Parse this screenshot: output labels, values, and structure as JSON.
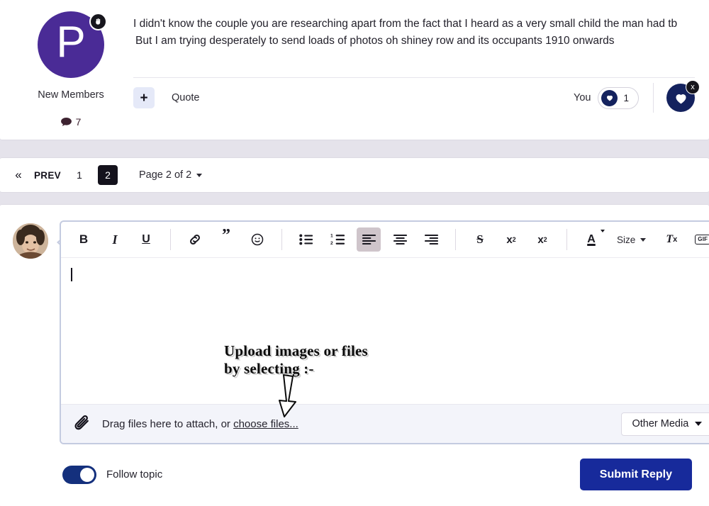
{
  "post": {
    "avatar_initial": "P",
    "rank_badge_icon": "hand-badge-icon",
    "member_group": "New Members",
    "post_count": "7",
    "body_lines": [
      "I didn't know the couple you are researching apart from the fact that I heard as a very small child the man had tb",
      "But I am trying desperately to send loads of photos oh shiney row and its occupants 1910 onwards"
    ],
    "plus_label": "+",
    "quote_label": "Quote",
    "reaction": {
      "you_label": "You",
      "count": "1",
      "heart_icon": "heart-icon",
      "remove_icon": "x"
    }
  },
  "pagination": {
    "first_icon": "«",
    "prev_label": "PREV",
    "pages": [
      {
        "label": "1",
        "active": false
      },
      {
        "label": "2",
        "active": true
      }
    ],
    "jump_label": "Page 2 of 2"
  },
  "editor": {
    "toolbar": [
      {
        "name": "bold-button",
        "label": "B"
      },
      {
        "name": "italic-button",
        "label": "I"
      },
      {
        "name": "underline-button",
        "label": "U"
      },
      {
        "name": "link-button",
        "label": "link-icon"
      },
      {
        "name": "quote-button",
        "label": "”"
      },
      {
        "name": "emoji-button",
        "label": "smiley-icon"
      },
      {
        "name": "bullet-list-button",
        "label": "bullet-list-icon"
      },
      {
        "name": "numbered-list-button",
        "label": "numbered-list-icon"
      },
      {
        "name": "align-left-button",
        "label": "align-left-icon"
      },
      {
        "name": "align-center-button",
        "label": "align-center-icon"
      },
      {
        "name": "align-right-button",
        "label": "align-right-icon"
      },
      {
        "name": "strikethrough-button",
        "label": "S"
      },
      {
        "name": "superscript-button",
        "label": "x²"
      },
      {
        "name": "subscript-button",
        "label": "x₂"
      },
      {
        "name": "text-color-button",
        "label": "A"
      },
      {
        "name": "font-size-button",
        "label": "Size"
      },
      {
        "name": "clear-formatting-button",
        "label": "Tx"
      },
      {
        "name": "gif-button",
        "label": "GIF"
      }
    ],
    "size_label": "Size",
    "gif_label": "GIF",
    "content": "",
    "attach": {
      "icon": "paperclip-icon",
      "text_before": "Drag files here to attach, or ",
      "link_text": "choose files...",
      "other_media_label": "Other Media"
    }
  },
  "footer": {
    "follow_label": "Follow topic",
    "follow_enabled": true,
    "submit_label": "Submit Reply"
  },
  "annotation": {
    "line1": "Upload images or files",
    "line2": "by selecting :-",
    "arrow": "down-arrow-annotation"
  },
  "colors": {
    "avatar_purple": "#4a2b96",
    "reaction_navy": "#14225e",
    "submit_blue": "#172a9b",
    "toggle_blue": "#14307d",
    "page_bg": "#e5e3eb"
  }
}
